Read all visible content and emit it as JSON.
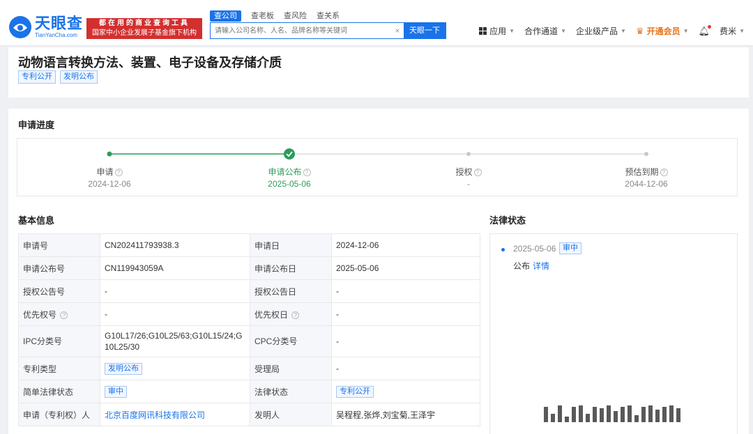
{
  "header": {
    "logo_cn": "天眼查",
    "logo_en": "TianYanCha.com",
    "slogan_line1": "都在用的商业查询工具",
    "slogan_line2": "国家中小企业发展子基金旗下机构",
    "search_tabs": [
      "查公司",
      "查老板",
      "查风险",
      "查关系"
    ],
    "search_placeholder": "请输入公司名称、人名、品牌名称等关键词",
    "search_clear": "×",
    "search_button": "天眼一下",
    "nav": {
      "apps": "应用",
      "partner": "合作通道",
      "enterprise": "企业级产品",
      "vip": "开通会员",
      "user": "费米"
    }
  },
  "title": "动物语言转换方法、装置、电子设备及存储介质",
  "title_tags": [
    "专利公开",
    "发明公布"
  ],
  "progress": {
    "section_title": "申请进度",
    "steps": [
      {
        "name": "申请",
        "date": "2024-12-06",
        "state": "done"
      },
      {
        "name": "申请公布",
        "date": "2025-05-06",
        "state": "current"
      },
      {
        "name": "授权",
        "date": "-",
        "state": "pending"
      },
      {
        "name": "预估到期",
        "date": "2044-12-06",
        "state": "pending"
      }
    ]
  },
  "basic_info": {
    "section_title": "基本信息",
    "rows": [
      {
        "l1": "申请号",
        "v1": "CN202411793938.3",
        "l2": "申请日",
        "v2": "2024-12-06"
      },
      {
        "l1": "申请公布号",
        "v1": "CN119943059A",
        "l2": "申请公布日",
        "v2": "2025-05-06"
      },
      {
        "l1": "授权公告号",
        "v1": "-",
        "l2": "授权公告日",
        "v2": "-"
      },
      {
        "l1": "优先权号",
        "v1": "-",
        "l2": "优先权日",
        "v2": "-"
      },
      {
        "l1": "IPC分类号",
        "v1": "G10L17/26;G10L25/63;G10L15/24;G10L25/30",
        "l2": "CPC分类号",
        "v2": "-"
      },
      {
        "l1": "专利类型",
        "v1": "发明公布",
        "l2": "受理局",
        "v2": "-"
      },
      {
        "l1": "简单法律状态",
        "v1": "审中",
        "l2": "法律状态",
        "v2": "专利公开"
      },
      {
        "l1": "申请（专利权）人",
        "v1": "北京百度网讯科技有限公司",
        "l2": "发明人",
        "v2": "吴程程,张烨,刘宝菊,王泽宇"
      }
    ]
  },
  "legal": {
    "section_title": "法律状态",
    "date": "2025-05-06",
    "status": "审中",
    "event": "公布",
    "detail_link": "详情"
  },
  "help_glyph": "?",
  "colors": {
    "brand": "#1a73e8",
    "progress_green": "#2e9b5a",
    "slogan_red": "#d32f2f",
    "vip_orange": "#e8731a"
  }
}
